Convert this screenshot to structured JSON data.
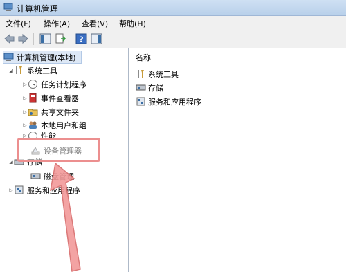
{
  "window": {
    "title": "计算机管理"
  },
  "menu": [
    {
      "label": "文件(F)"
    },
    {
      "label": "操作(A)"
    },
    {
      "label": "查看(V)"
    },
    {
      "label": "帮助(H)"
    }
  ],
  "tree": {
    "root": "计算机管理(本地)",
    "system_tools": "系统工具",
    "task_scheduler": "任务计划程序",
    "event_viewer": "事件查看器",
    "shared_folders": "共享文件夹",
    "local_users": "本地用户和组",
    "performance": "性能",
    "device_manager": "设备管理器",
    "storage": "存储",
    "disk_management": "磁盘管理",
    "services_apps": "服务和应用程序"
  },
  "list": {
    "column_header": "名称",
    "items": [
      {
        "label": "系统工具",
        "icon": "tools-icon"
      },
      {
        "label": "存储",
        "icon": "storage-icon"
      },
      {
        "label": "服务和应用程序",
        "icon": "services-icon"
      }
    ]
  },
  "annotation": {
    "color": "#ec8f8f"
  }
}
